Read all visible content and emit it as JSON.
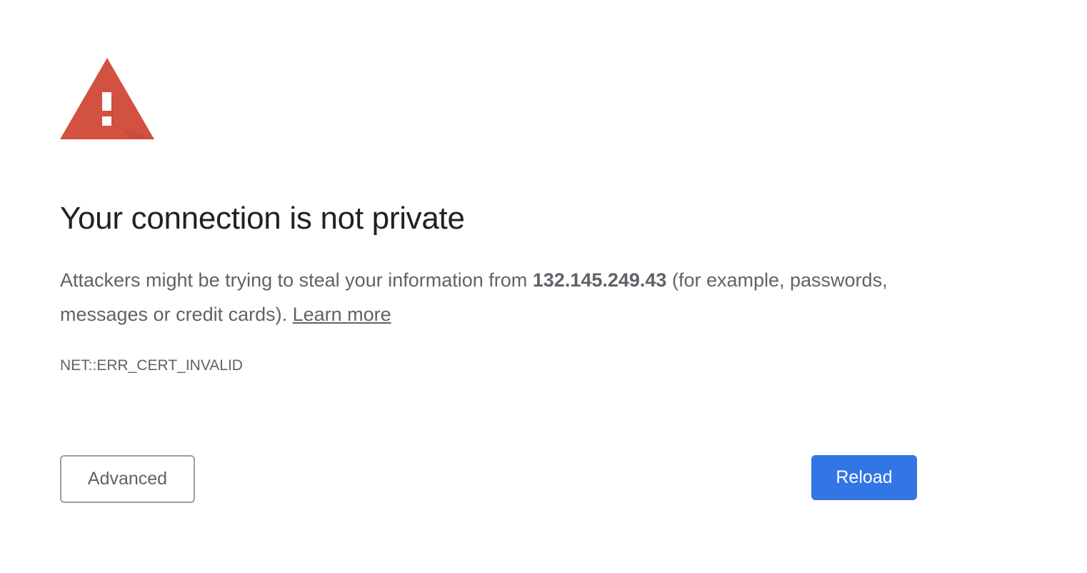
{
  "interstitial": {
    "icon": "warning-triangle-icon",
    "icon_color": "#d25140",
    "icon_shadow_color": "#b8473a",
    "heading": "Your connection is not private",
    "explanation_before": "Attackers might be trying to steal your information from ",
    "host": "132.145.249.43",
    "explanation_after": " (for example, passwords, messages or credit cards). ",
    "learn_more_label": "Learn more",
    "error_code": "NET::ERR_CERT_INVALID"
  },
  "buttons": {
    "advanced_label": "Advanced",
    "reload_label": "Reload",
    "reload_color": "#3275e4"
  }
}
